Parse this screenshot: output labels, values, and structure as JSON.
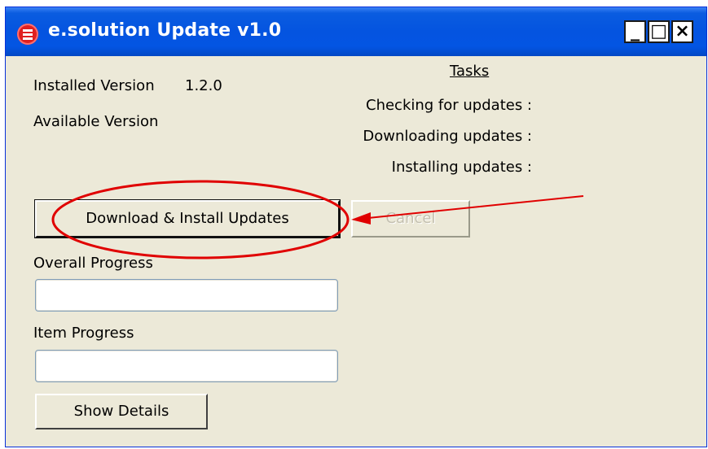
{
  "window": {
    "title": "e.solution Update v1.0",
    "controls": {
      "minimize": "_",
      "maximize": "□",
      "close": "×"
    }
  },
  "versions": {
    "installed_label": "Installed Version",
    "installed_value": "1.2.0",
    "available_label": "Available Version",
    "available_value": ""
  },
  "tasks": {
    "title": "Tasks",
    "items": [
      "Checking for updates :",
      "Downloading updates :",
      "Installing updates :"
    ]
  },
  "buttons": {
    "download_install": "Download & Install Updates",
    "cancel": "Cancel",
    "show_details": "Show Details"
  },
  "progress": {
    "overall_label": "Overall Progress",
    "overall_value": 0,
    "item_label": "Item Progress",
    "item_value": 0
  },
  "colors": {
    "titlebar": "#0454e0",
    "window_bg": "#ece9d8",
    "annotation": "#e00000"
  },
  "icons": {
    "app": "app-logo-icon",
    "annotation_circle": "highlight-ellipse",
    "annotation_arrow": "red-arrow"
  }
}
